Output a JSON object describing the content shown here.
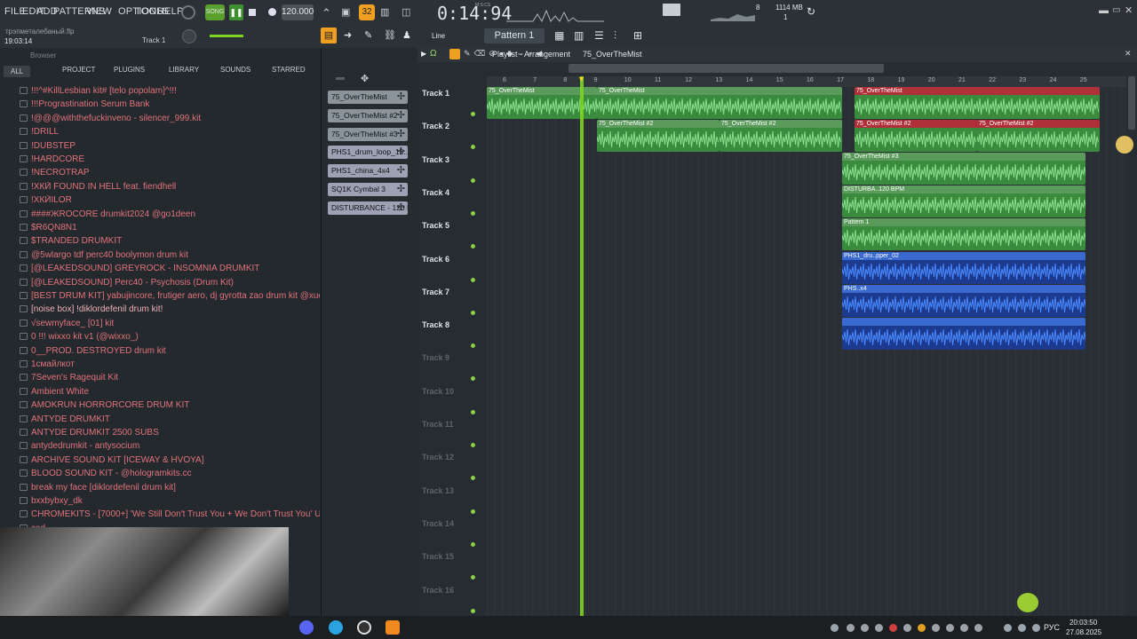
{
  "menu": [
    "FILE",
    "EDIT",
    "ADD",
    "PATTERNS",
    "VIEW",
    "OPTIONS",
    "TOOLS",
    "HELP"
  ],
  "transport": {
    "mode": "SONG",
    "tempo": "120.000",
    "time": "0:14:94",
    "time_label": "M:S:CS",
    "pattern_btn": "32"
  },
  "cpu": {
    "cpu": "8",
    "memory": "1114 MB",
    "voices": "1"
  },
  "project": {
    "name": "трэпметалебаный.flp",
    "elapsed": "19:03:14",
    "track_hint": "Track 1"
  },
  "toolbar2": {
    "snap": "Line",
    "pattern": "Pattern 1"
  },
  "browser": {
    "title": "Browser",
    "tabs": [
      "ALL",
      "PROJECT",
      "PLUGINS",
      "LIBRARY",
      "SOUNDS",
      "STARRED"
    ],
    "items": [
      "!!!^#KillLesbian kit# [telo popolam]^!!!",
      "!!!Prograstination Serum Bank",
      "!@@@withthefuckinveno - silencer_999.kit",
      "!DRILL",
      "!DUBSTEP",
      "!HARDCORE",
      "!NECROTRAP",
      "!ХКЙ FOUND IN HELL feat. fiendhell",
      "!ХКЙILOR",
      "####ЖROCORE drumkit2024 @go1deen",
      "$R6QN8N1",
      "$TRANDED DRUMKIT",
      "@5wlargo tdf perc40 boolymon drum kit",
      "[@LEAKEDSOUND] GREYROCK - INSOMNIA DRUMKIT",
      "[@LEAKEDSOUND] Perc40 - Psychosis (Drum Kit)",
      "[BEST DRUM KIT] yabujincore, frutiger aero, dj gyrotta zao drum kit @xuorwa",
      "[noise box] !diklordefenil drum kit!",
      "√sewmyface_ [01] kit",
      "0 !!! wixxo kit v1 (@wixxo_)",
      "0__PROD. DESTROYED drum kit",
      "1смайлкот",
      "7Seven's Ragequit Kit",
      "Ambient White",
      "AMOKRUN HORRORCORE DRUM KIT",
      "ANTYDE DRUMKIT",
      "ANTYDE DRUMKIT 2500 SUBS",
      "antydedrumkit - antysocium",
      "ARCHIVE SOUND KIT [ICEWAY & HVOYA]",
      "BLOOD SOUND KIT - @hologramkits.cc",
      "break my face [diklordefenil drum kit]",
      "bxxbybxy_dk",
      "CHROMEKITS - [7000+] 'We Still Don't Trust You + We Don't Trust You' ULTIMATE Drum Kit",
      "cod"
    ]
  },
  "channels": [
    "75_OverTheMist",
    "75_OverTheMist #2",
    "75_OverTheMist #3",
    "PHS1_drum_loop_15...",
    "PHS1_china_4x4",
    "SQ1K Cymbal 3",
    "DISTURBANCE - 120 B..."
  ],
  "playlist": {
    "title": "Playlist - Arrangement",
    "crumb": "75_OverTheMist",
    "bars": [
      "6",
      "7",
      "8",
      "9",
      "10",
      "11",
      "12",
      "13",
      "14",
      "15",
      "16",
      "17",
      "18",
      "19",
      "20",
      "21",
      "22",
      "23",
      "24",
      "25"
    ],
    "tracks": [
      "Track 1",
      "Track 2",
      "Track 3",
      "Track 4",
      "Track 5",
      "Track 6",
      "Track 7",
      "Track 8",
      "Track 9",
      "Track 10",
      "Track 11",
      "Track 12",
      "Track 13",
      "Track 14",
      "Track 15",
      "Track 16"
    ],
    "clips": {
      "t1a": "75_OverTheMist",
      "t1b": "75_OverTheMist",
      "t1c": "75_OverTheMist",
      "t2a": "75_OverTheMist #2",
      "t2b": "75_OverTheMist #2",
      "t2c": "75_OverTheMist #2",
      "t2d": "75_OverTheMist #2",
      "t3": "75_OverTheMist #3",
      "t4": "DISTURBA..120 BPM",
      "t5": "Pattern 1",
      "t6": "PHS1_dru..pper_02",
      "t7": "PHS..x4",
      "t8": ""
    }
  },
  "taskbar": {
    "lang": "РУС",
    "clock": "20:03:50",
    "date": "27.08.2025"
  },
  "colors": {
    "accent_orange": "#f0a020",
    "clip_green": "#3a8b3e",
    "clip_red": "#b0303a",
    "clip_blue": "#1c3a8e",
    "playhead": "#7ed321"
  }
}
